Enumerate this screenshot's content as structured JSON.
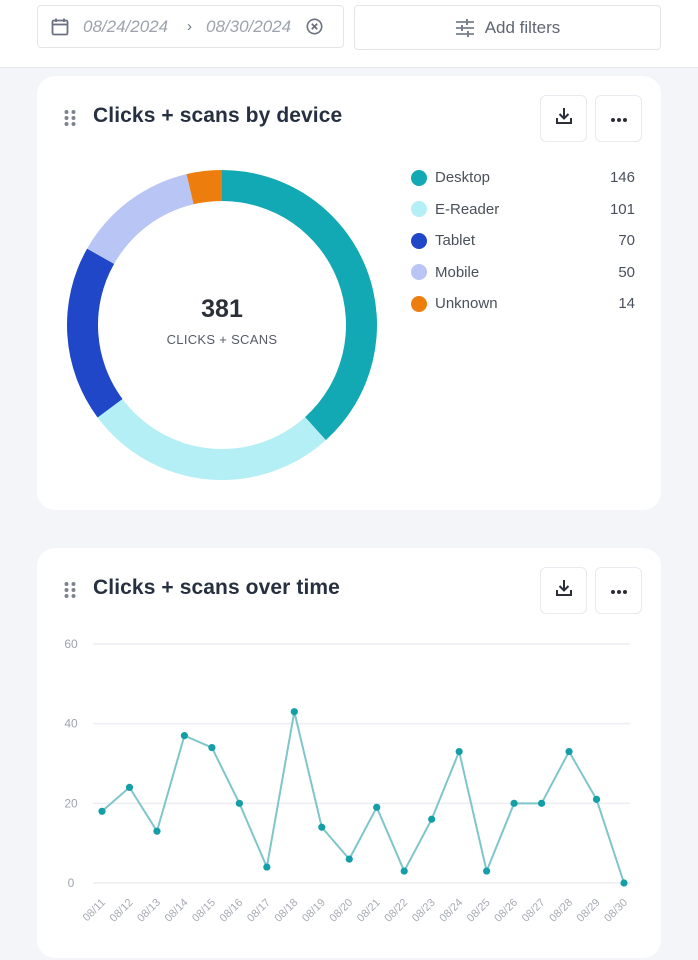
{
  "filters": {
    "start_date": "08/24/2024",
    "date_separator": "›",
    "end_date": "08/30/2024",
    "add_filters_label": "Add filters"
  },
  "icons": {
    "calendar": "calendar-icon",
    "clear": "clear-circle-x-icon",
    "tune": "sliders-icon",
    "drag": "drag-handle-icon",
    "download": "download-icon",
    "more": "more-horizontal-icon"
  },
  "colors": {
    "desktop": "#12a9b4",
    "ereader": "#b3eff5",
    "tablet": "#1f47c7",
    "mobile": "#b8c5f5",
    "unknown": "#ed7d0c",
    "line": "#7fc6ca",
    "point": "#149ea7"
  },
  "device_card": {
    "title": "Clicks + scans by device",
    "total": "381",
    "total_label": "CLICKS + SCANS"
  },
  "time_card": {
    "title": "Clicks + scans over time"
  },
  "chart_data": [
    {
      "type": "pie",
      "variant": "donut",
      "title": "Clicks + scans by device",
      "center_value": 381,
      "center_label": "CLICKS + SCANS",
      "categories": [
        "Desktop",
        "E-Reader",
        "Tablet",
        "Mobile",
        "Unknown"
      ],
      "values": [
        146,
        101,
        70,
        50,
        14
      ],
      "colors": [
        "#12a9b4",
        "#b3eff5",
        "#1f47c7",
        "#b8c5f5",
        "#ed7d0c"
      ],
      "start": "top",
      "direction": "clockwise",
      "legend": "right"
    },
    {
      "type": "line",
      "title": "Clicks + scans over time",
      "xlabel": "",
      "ylabel": "",
      "x": [
        "08/11",
        "08/12",
        "08/13",
        "08/14",
        "08/15",
        "08/16",
        "08/17",
        "08/18",
        "08/19",
        "08/20",
        "08/21",
        "08/22",
        "08/23",
        "08/24",
        "08/25",
        "08/26",
        "08/27",
        "08/28",
        "08/29",
        "08/30"
      ],
      "series": [
        {
          "name": "Clicks + scans",
          "values": [
            18,
            24,
            13,
            37,
            34,
            20,
            4,
            43,
            14,
            6,
            19,
            3,
            16,
            33,
            3,
            20,
            20,
            33,
            21,
            0
          ]
        }
      ],
      "ylim": [
        0,
        60
      ],
      "yticks": [
        0,
        20,
        40,
        60
      ],
      "grid": true,
      "legend": "none"
    }
  ]
}
